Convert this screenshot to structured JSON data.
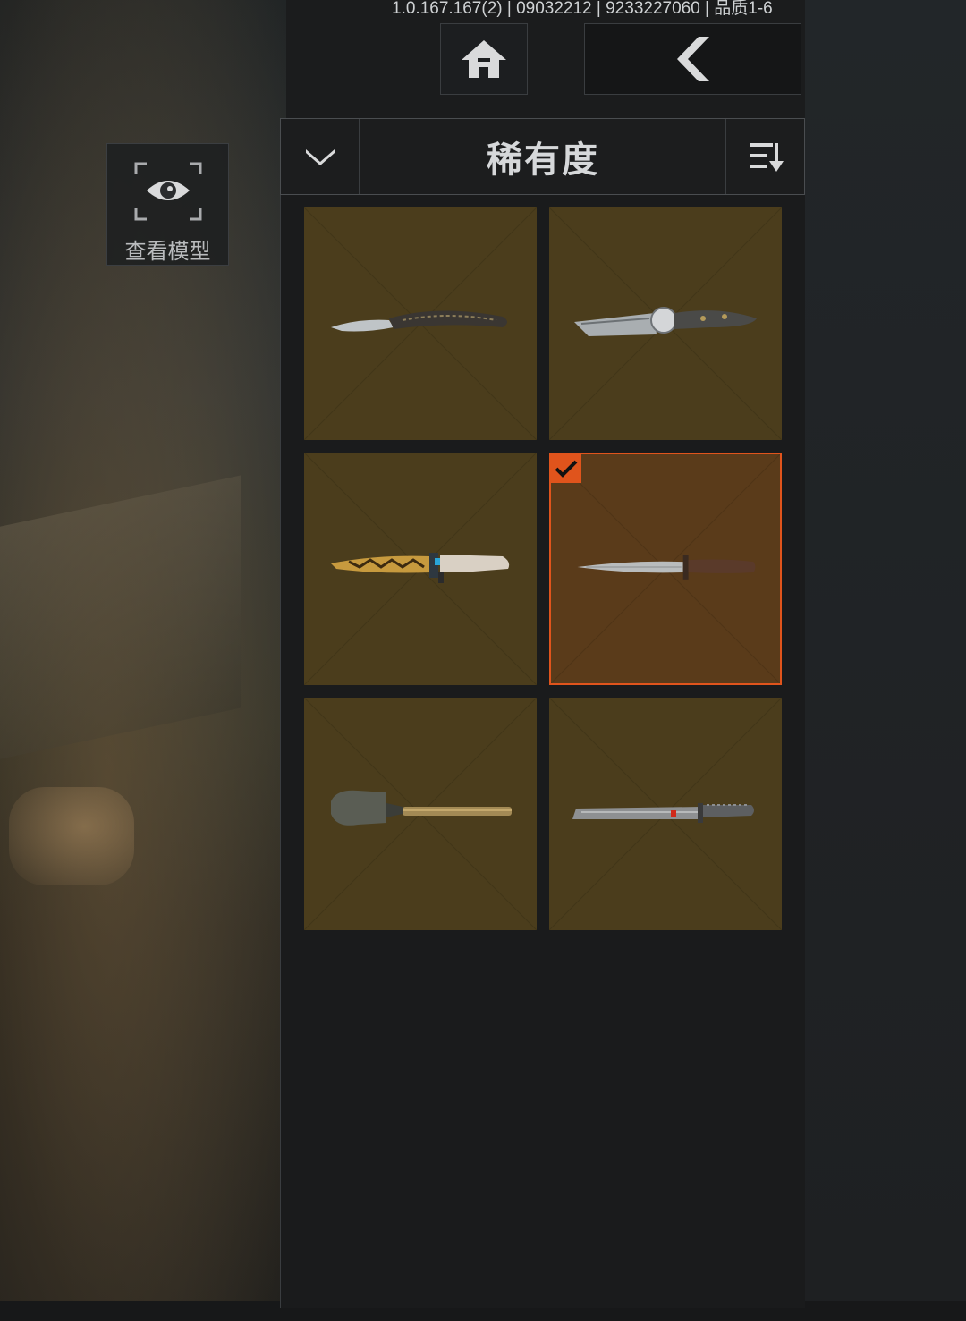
{
  "version_text": "1.0.167.167(2) | 09032212 | 9233227060 | 品质1-6",
  "nav": {
    "home_icon": "home-icon",
    "back_icon": "chevron-left-icon"
  },
  "view_model": {
    "label": "查看模型",
    "icon": "eye-icon"
  },
  "sort_bar": {
    "label": "稀有度",
    "dropdown_icon": "chevron-down-icon",
    "order_icon": "sort-descending-icon"
  },
  "items": [
    {
      "name": "karambit-style-knife",
      "selected": false
    },
    {
      "name": "ornate-folding-knife",
      "selected": false
    },
    {
      "name": "gold-pattern-combat-knife",
      "selected": false
    },
    {
      "name": "dagger",
      "selected": true
    },
    {
      "name": "entrenching-shovel",
      "selected": false
    },
    {
      "name": "machete",
      "selected": false
    }
  ],
  "colors": {
    "card_bg": "#4b3d1c",
    "selected_border": "#e0541c",
    "selected_bg": "#5a3b1a"
  }
}
